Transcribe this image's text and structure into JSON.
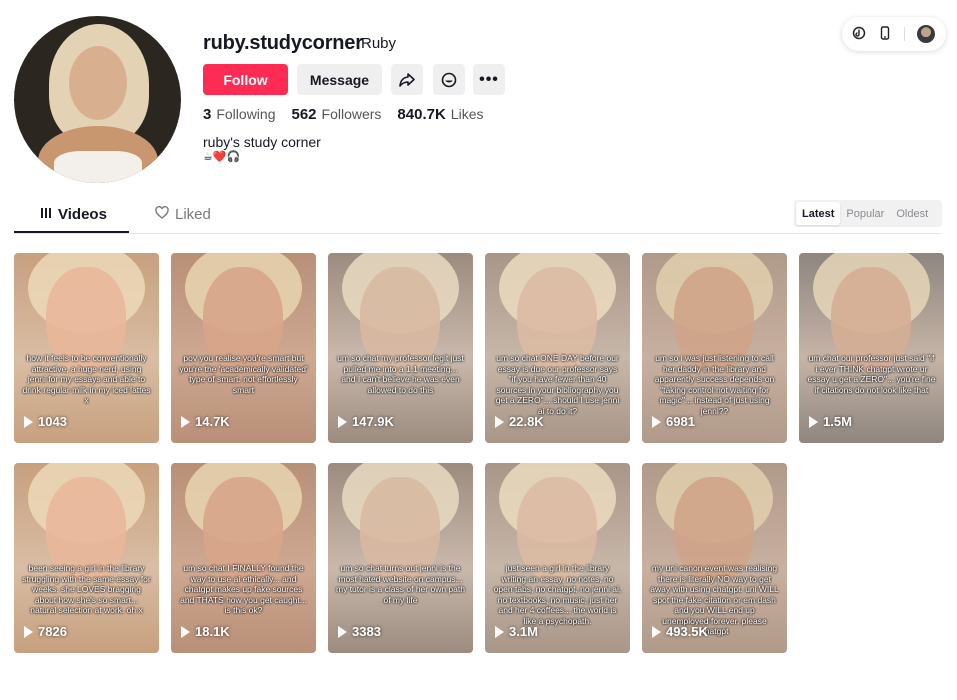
{
  "profile": {
    "username": "ruby.studycorner",
    "nickname": "Ruby",
    "follow_label": "Follow",
    "message_label": "Message",
    "following_count": "3",
    "following_label": "Following",
    "followers_count": "562",
    "followers_label": "Followers",
    "likes_count": "840.7K",
    "likes_label": "Likes",
    "bio": "ruby's study corner",
    "bio_emojis": "☕❤️🎧",
    "accent_color": "#fe2c55"
  },
  "tabs": {
    "videos": "Videos",
    "liked": "Liked"
  },
  "sort": {
    "latest": "Latest",
    "popular": "Popular",
    "oldest": "Oldest",
    "selected": "Latest"
  },
  "videos": [
    {
      "views": "1043",
      "caption": "how it feels to be conventionally attractive, a huge nerd, using jenni for my essays and able to drink regular milk in my iced lattes x"
    },
    {
      "views": "14.7K",
      "caption": "pov you realise you're smart but you're the 'academically validated' type of smart. not effortlessly smart"
    },
    {
      "views": "147.9K",
      "caption": "um so chat my professor legit just pulled me into a 1:1 meeting... and I can't believe he was even allowed to do this"
    },
    {
      "views": "22.8K",
      "caption": "um so chat ONE DAY before our essay is due our professor says \"if you have fewer than 40 sources in your bibliography you get a ZERO\"... should I use jenni ai to do it?"
    },
    {
      "views": "6981",
      "caption": "um so i was just listening to call her daddy in the library and apparently success depends on \"taking control not waiting for magic\"... instead of just using jenni??"
    },
    {
      "views": "1.5M",
      "caption": "um chat our professor just said \"if i ever THINK chatgpt wrote ur essay u get a ZERO\"... you're fine if citations do not look like that"
    },
    {
      "views": "7826",
      "caption": "been seeing a girl in the library struggling with the same essay for weeks. she LOVES bragging about how she's so smart... natural selection at work. oh x"
    },
    {
      "views": "18.1K",
      "caption": "um so chat I FINALLY found the way to use ai ethically... and chatgpt makes up fake sources and THATS how you get caught... is this ok?"
    },
    {
      "views": "3383",
      "caption": "um so chat turns out jenni is the most hated website on campus... my tutor is a class of her own path of my life"
    },
    {
      "views": "3.1M",
      "caption": "just seen a girl in the library writing an essay, no notes, no open tabs, no chatgpt, no jenni ai, no textbooks, no music, just her and her 4 coffees... the world is like a psychopath."
    },
    {
      "views": "493.5K",
      "caption": "my uni canon event was realising there is literally NO way to get away with using chatgpt. uni WILL spot the fake citation or em dash and you WILL end up unemployed forever. please chatgpt"
    }
  ]
}
